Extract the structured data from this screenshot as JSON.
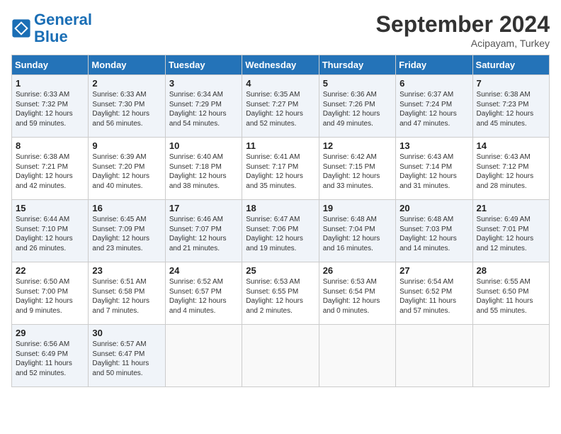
{
  "logo": {
    "line1": "General",
    "line2": "Blue"
  },
  "title": "September 2024",
  "location": "Acipayam, Turkey",
  "days_header": [
    "Sunday",
    "Monday",
    "Tuesday",
    "Wednesday",
    "Thursday",
    "Friday",
    "Saturday"
  ],
  "weeks": [
    [
      {
        "day": "1",
        "info": "Sunrise: 6:33 AM\nSunset: 7:32 PM\nDaylight: 12 hours\nand 59 minutes."
      },
      {
        "day": "2",
        "info": "Sunrise: 6:33 AM\nSunset: 7:30 PM\nDaylight: 12 hours\nand 56 minutes."
      },
      {
        "day": "3",
        "info": "Sunrise: 6:34 AM\nSunset: 7:29 PM\nDaylight: 12 hours\nand 54 minutes."
      },
      {
        "day": "4",
        "info": "Sunrise: 6:35 AM\nSunset: 7:27 PM\nDaylight: 12 hours\nand 52 minutes."
      },
      {
        "day": "5",
        "info": "Sunrise: 6:36 AM\nSunset: 7:26 PM\nDaylight: 12 hours\nand 49 minutes."
      },
      {
        "day": "6",
        "info": "Sunrise: 6:37 AM\nSunset: 7:24 PM\nDaylight: 12 hours\nand 47 minutes."
      },
      {
        "day": "7",
        "info": "Sunrise: 6:38 AM\nSunset: 7:23 PM\nDaylight: 12 hours\nand 45 minutes."
      }
    ],
    [
      {
        "day": "8",
        "info": "Sunrise: 6:38 AM\nSunset: 7:21 PM\nDaylight: 12 hours\nand 42 minutes."
      },
      {
        "day": "9",
        "info": "Sunrise: 6:39 AM\nSunset: 7:20 PM\nDaylight: 12 hours\nand 40 minutes."
      },
      {
        "day": "10",
        "info": "Sunrise: 6:40 AM\nSunset: 7:18 PM\nDaylight: 12 hours\nand 38 minutes."
      },
      {
        "day": "11",
        "info": "Sunrise: 6:41 AM\nSunset: 7:17 PM\nDaylight: 12 hours\nand 35 minutes."
      },
      {
        "day": "12",
        "info": "Sunrise: 6:42 AM\nSunset: 7:15 PM\nDaylight: 12 hours\nand 33 minutes."
      },
      {
        "day": "13",
        "info": "Sunrise: 6:43 AM\nSunset: 7:14 PM\nDaylight: 12 hours\nand 31 minutes."
      },
      {
        "day": "14",
        "info": "Sunrise: 6:43 AM\nSunset: 7:12 PM\nDaylight: 12 hours\nand 28 minutes."
      }
    ],
    [
      {
        "day": "15",
        "info": "Sunrise: 6:44 AM\nSunset: 7:10 PM\nDaylight: 12 hours\nand 26 minutes."
      },
      {
        "day": "16",
        "info": "Sunrise: 6:45 AM\nSunset: 7:09 PM\nDaylight: 12 hours\nand 23 minutes."
      },
      {
        "day": "17",
        "info": "Sunrise: 6:46 AM\nSunset: 7:07 PM\nDaylight: 12 hours\nand 21 minutes."
      },
      {
        "day": "18",
        "info": "Sunrise: 6:47 AM\nSunset: 7:06 PM\nDaylight: 12 hours\nand 19 minutes."
      },
      {
        "day": "19",
        "info": "Sunrise: 6:48 AM\nSunset: 7:04 PM\nDaylight: 12 hours\nand 16 minutes."
      },
      {
        "day": "20",
        "info": "Sunrise: 6:48 AM\nSunset: 7:03 PM\nDaylight: 12 hours\nand 14 minutes."
      },
      {
        "day": "21",
        "info": "Sunrise: 6:49 AM\nSunset: 7:01 PM\nDaylight: 12 hours\nand 12 minutes."
      }
    ],
    [
      {
        "day": "22",
        "info": "Sunrise: 6:50 AM\nSunset: 7:00 PM\nDaylight: 12 hours\nand 9 minutes."
      },
      {
        "day": "23",
        "info": "Sunrise: 6:51 AM\nSunset: 6:58 PM\nDaylight: 12 hours\nand 7 minutes."
      },
      {
        "day": "24",
        "info": "Sunrise: 6:52 AM\nSunset: 6:57 PM\nDaylight: 12 hours\nand 4 minutes."
      },
      {
        "day": "25",
        "info": "Sunrise: 6:53 AM\nSunset: 6:55 PM\nDaylight: 12 hours\nand 2 minutes."
      },
      {
        "day": "26",
        "info": "Sunrise: 6:53 AM\nSunset: 6:54 PM\nDaylight: 12 hours\nand 0 minutes."
      },
      {
        "day": "27",
        "info": "Sunrise: 6:54 AM\nSunset: 6:52 PM\nDaylight: 11 hours\nand 57 minutes."
      },
      {
        "day": "28",
        "info": "Sunrise: 6:55 AM\nSunset: 6:50 PM\nDaylight: 11 hours\nand 55 minutes."
      }
    ],
    [
      {
        "day": "29",
        "info": "Sunrise: 6:56 AM\nSunset: 6:49 PM\nDaylight: 11 hours\nand 52 minutes."
      },
      {
        "day": "30",
        "info": "Sunrise: 6:57 AM\nSunset: 6:47 PM\nDaylight: 11 hours\nand 50 minutes."
      },
      {
        "day": "",
        "info": ""
      },
      {
        "day": "",
        "info": ""
      },
      {
        "day": "",
        "info": ""
      },
      {
        "day": "",
        "info": ""
      },
      {
        "day": "",
        "info": ""
      }
    ]
  ]
}
